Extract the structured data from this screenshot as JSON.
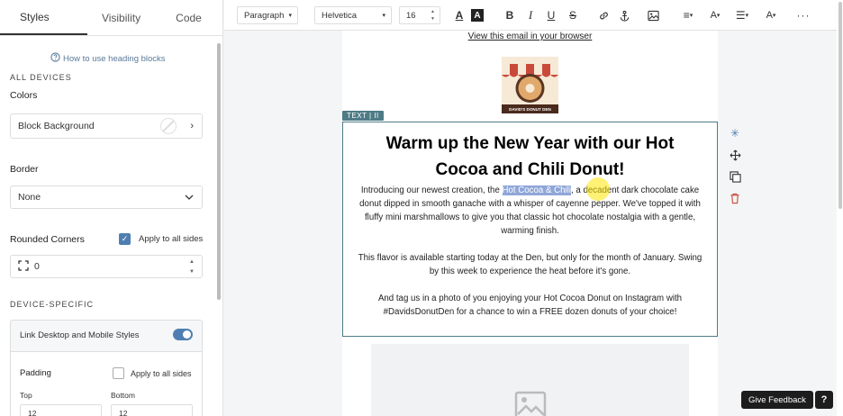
{
  "sidebar": {
    "tabs": [
      "Styles",
      "Visibility",
      "Code"
    ],
    "help_link": "How to use heading blocks",
    "all_devices": "ALL DEVICES",
    "colors_label": "Colors",
    "block_background": "Block Background",
    "border_label": "Border",
    "border_value": "None",
    "rounded_label": "Rounded Corners",
    "apply_all_sides": "Apply to all sides",
    "rounded_value": "0",
    "device_specific": "DEVICE-SPECIFIC",
    "link_styles": "Link Desktop and Mobile Styles",
    "padding_label": "Padding",
    "padding_apply": "Apply to all sides",
    "top_label": "Top",
    "bottom_label": "Bottom",
    "top_value": "12",
    "bottom_value": "12"
  },
  "toolbar": {
    "block_type": "Paragraph",
    "font": "Helvetica",
    "font_size": "16"
  },
  "email": {
    "view_link": "View this email in your browser",
    "logo_text": "DAVID'S DONUT DEN",
    "text_tag": "TEXT | II",
    "heading": "Warm up the New Year with our Hot Cocoa and Chili Donut!",
    "p1_before": "Introducing our newest creation, the ",
    "p1_highlight": "Hot Cocoa & Chili",
    "p1_after": ", a decadent dark chocolate cake donut dipped in smooth ganache with a whisper of cayenne pepper. We've topped it with fluffy mini marshmallows to give you that classic hot chocolate nostalgia with a gentle, warming finish.",
    "p2": "This flavor is available starting today at the Den, but only for the month of January. Swing by this week to experience the heat before it's gone.",
    "p3": "And tag us in a photo of you enjoying your Hot Cocoa Donut on Instagram with #DavidsDonutDen for a chance to win a FREE dozen donuts of your choice!"
  },
  "feedback": "Give Feedback",
  "help": "?",
  "colors": {
    "accent": "#4f7fb2",
    "selection": "#4e7b86"
  }
}
